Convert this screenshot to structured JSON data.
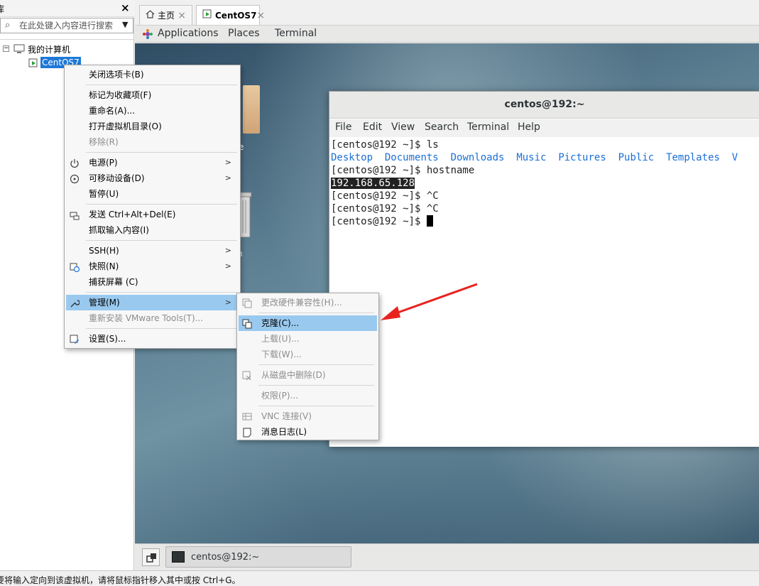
{
  "library": {
    "title": "库",
    "search_placeholder": "在此处键入内容进行搜索",
    "tree": {
      "root": "我的计算机",
      "vm": "CentOS7"
    }
  },
  "tabs": [
    {
      "label": "主页"
    },
    {
      "label": "CentOS7"
    }
  ],
  "gnome": {
    "applications": "Applications",
    "places": "Places",
    "terminal": "Terminal"
  },
  "desktop": {
    "folder_label_fragment": "e",
    "trash_label_fragment": "n"
  },
  "terminal": {
    "title": "centos@192:~",
    "menu": [
      "File",
      "Edit",
      "View",
      "Search",
      "Terminal",
      "Help"
    ],
    "prompt": "[centos@192 ~]$ ",
    "cmd_ls": "ls",
    "ls_output": [
      "Desktop",
      "Documents",
      "Downloads",
      "Music",
      "Pictures",
      "Public",
      "Templates",
      "V"
    ],
    "cmd_hostname": "hostname",
    "hostname_output": "192.168.65.128",
    "ctrl_c": "^C"
  },
  "context_menu": {
    "close_tab": "关闭选项卡(B)",
    "favorite": "标记为收藏项(F)",
    "rename": "重命名(A)...",
    "open_dir": "打开虚拟机目录(O)",
    "remove": "移除(R)",
    "power": "电源(P)",
    "removable": "可移动设备(D)",
    "pause": "暂停(U)",
    "send_cad": "发送 Ctrl+Alt+Del(E)",
    "grab_input": "抓取输入内容(I)",
    "ssh": "SSH(H)",
    "snapshot": "快照(N)",
    "capture": "捕获屏幕 (C)",
    "manage": "管理(M)",
    "reinstall_tools": "重新安装 VMware Tools(T)...",
    "settings": "设置(S)..."
  },
  "submenu": {
    "upgrade_hw": "更改硬件兼容性(H)...",
    "clone": "克隆(C)...",
    "upload": "上载(U)...",
    "download": "下载(W)...",
    "delete_disk": "从磁盘中删除(D)",
    "permissions": "权限(P)...",
    "vnc": "VNC 连接(V)",
    "msg_log": "消息日志(L)"
  },
  "taskbar": {
    "terminal_task": "centos@192:~"
  },
  "status": {
    "text": "要将输入定向到该虚拟机，请将鼠标指针移入其中或按 Ctrl+G。"
  },
  "colors": {
    "accent": "#1e78d7",
    "menu_highlight": "#99c9ef",
    "arrow": "#e8231f",
    "terminal_link": "#1c6fd6"
  }
}
